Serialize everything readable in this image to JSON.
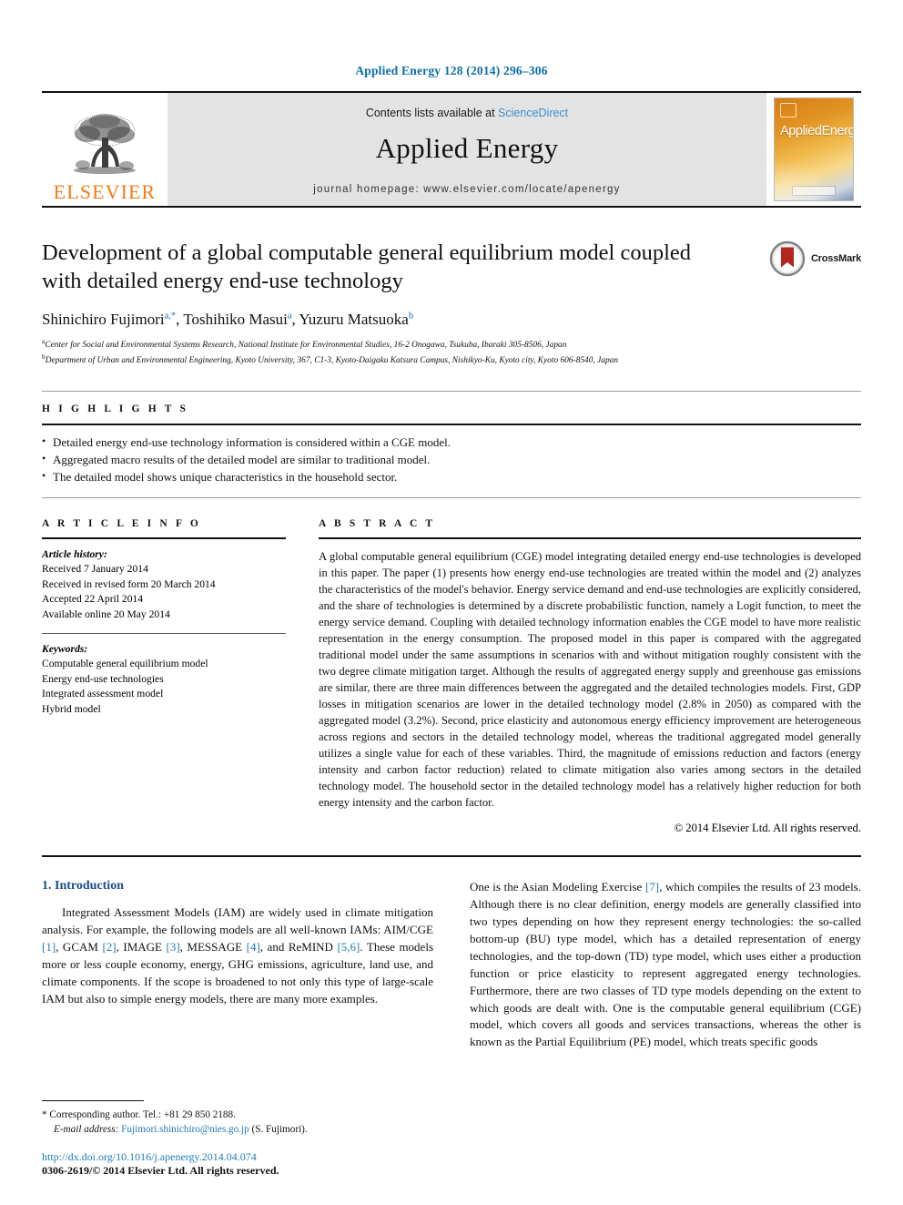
{
  "running_head": "Applied Energy 128 (2014) 296–306",
  "masthead": {
    "publisher_name": "ELSEVIER",
    "contents_prefix": "Contents lists available at ",
    "contents_link": "ScienceDirect",
    "journal_title": "Applied Energy",
    "homepage": "journal homepage: www.elsevier.com/locate/apenergy",
    "cover_title_applied": "Applied",
    "cover_title_energy": "Energy"
  },
  "article": {
    "title": "Development of a global computable general equilibrium model coupled with detailed energy end-use technology",
    "authors_html": "Shinichiro Fujimori a,*, Toshihiko Masui a, Yuzuru Matsuoka b",
    "authors": [
      {
        "name": "Shinichiro Fujimori",
        "marks": "a,*"
      },
      {
        "name": "Toshihiko Masui",
        "marks": "a"
      },
      {
        "name": "Yuzuru Matsuoka",
        "marks": "b"
      }
    ],
    "affiliations": [
      {
        "mark": "a",
        "text": "Center for Social and Environmental Systems Research, National Institute for Environmental Studies, 16-2 Onogawa, Tsukuba, Ibaraki 305-8506, Japan"
      },
      {
        "mark": "b",
        "text": "Department of Urban and Environmental Engineering, Kyoto University, 367, C1-3, Kyoto-Daigaku Katsura Campus, Nishikyo-Ku, Kyoto city, Kyoto 606-8540, Japan"
      }
    ],
    "crossmark_label": "CrossMark"
  },
  "highlights": {
    "heading": "H I G H L I G H T S",
    "items": [
      "Detailed energy end-use technology information is considered within a CGE model.",
      "Aggregated macro results of the detailed model are similar to traditional model.",
      "The detailed model shows unique characteristics in the household sector."
    ]
  },
  "article_info": {
    "heading": "A R T I C L E   I N F O",
    "history_label": "Article history:",
    "history": [
      "Received 7 January 2014",
      "Received in revised form 20 March 2014",
      "Accepted 22 April 2014",
      "Available online 20 May 2014"
    ],
    "keywords_label": "Keywords:",
    "keywords": [
      "Computable general equilibrium model",
      "Energy end-use technologies",
      "Integrated assessment model",
      "Hybrid model"
    ]
  },
  "abstract": {
    "heading": "A B S T R A C T",
    "text": "A global computable general equilibrium (CGE) model integrating detailed energy end-use technologies is developed in this paper. The paper (1) presents how energy end-use technologies are treated within the model and (2) analyzes the characteristics of the model's behavior. Energy service demand and end-use technologies are explicitly considered, and the share of technologies is determined by a discrete probabilistic function, namely a Logit function, to meet the energy service demand. Coupling with detailed technology information enables the CGE model to have more realistic representation in the energy consumption. The proposed model in this paper is compared with the aggregated traditional model under the same assumptions in scenarios with and without mitigation roughly consistent with the two degree climate mitigation target. Although the results of aggregated energy supply and greenhouse gas emissions are similar, there are three main differences between the aggregated and the detailed technologies models. First, GDP losses in mitigation scenarios are lower in the detailed technology model (2.8% in 2050) as compared with the aggregated model (3.2%). Second, price elasticity and autonomous energy efficiency improvement are heterogeneous across regions and sectors in the detailed technology model, whereas the traditional aggregated model generally utilizes a single value for each of these variables. Third, the magnitude of emissions reduction and factors (energy intensity and carbon factor reduction) related to climate mitigation also varies among sectors in the detailed technology model. The household sector in the detailed technology model has a relatively higher reduction for both energy intensity and the carbon factor.",
    "copyright": "© 2014 Elsevier Ltd. All rights reserved."
  },
  "body": {
    "section_title": "1. Introduction",
    "left_paragraph_parts": [
      "Integrated Assessment Models (IAM) are widely used in climate mitigation analysis. For example, the following models are all well-known IAMs: AIM/CGE ",
      "[1]",
      ", GCAM ",
      "[2]",
      ", IMAGE ",
      "[3]",
      ", MESSAGE ",
      "[4]",
      ", and ReMIND ",
      "[5,6]",
      ". These models more or less couple economy, energy, GHG emissions, agriculture, land use, and climate components. If the scope is broadened to not only this type of large-scale IAM but also to simple energy models, there are many more examples."
    ],
    "right_paragraph_parts": [
      "One is the Asian Modeling Exercise ",
      "[7]",
      ", which compiles the results of 23 models. Although there is no clear definition, energy models are generally classified into two types depending on how they represent energy technologies: the so-called bottom-up (BU) type model, which has a detailed representation of energy technologies, and the top-down (TD) type model, which uses either a production function or price elasticity to represent aggregated energy technologies. Furthermore, there are two classes of TD type models depending on the extent to which goods are dealt with. One is the computable general equilibrium (CGE) model, which covers all goods and services transactions, whereas the other is known as the Partial Equilibrium (PE) model, which treats specific goods"
    ]
  },
  "footnote": {
    "corresponding": "* Corresponding author. Tel.: +81 29 850 2188.",
    "email_label": "E-mail address:",
    "email": "Fujimori.shinichiro@nies.go.jp",
    "email_suffix": "(S. Fujimori).",
    "doi": "http://dx.doi.org/10.1016/j.apenergy.2014.04.074",
    "issn": "0306-2619/© 2014 Elsevier Ltd. All rights reserved."
  },
  "colors": {
    "link_blue": "#1c7bb8",
    "header_blue": "#0b6ea8",
    "elsevier_orange": "#f07c19",
    "section_blue": "#1a4f8a",
    "band_gray": "#e3e3e3"
  }
}
